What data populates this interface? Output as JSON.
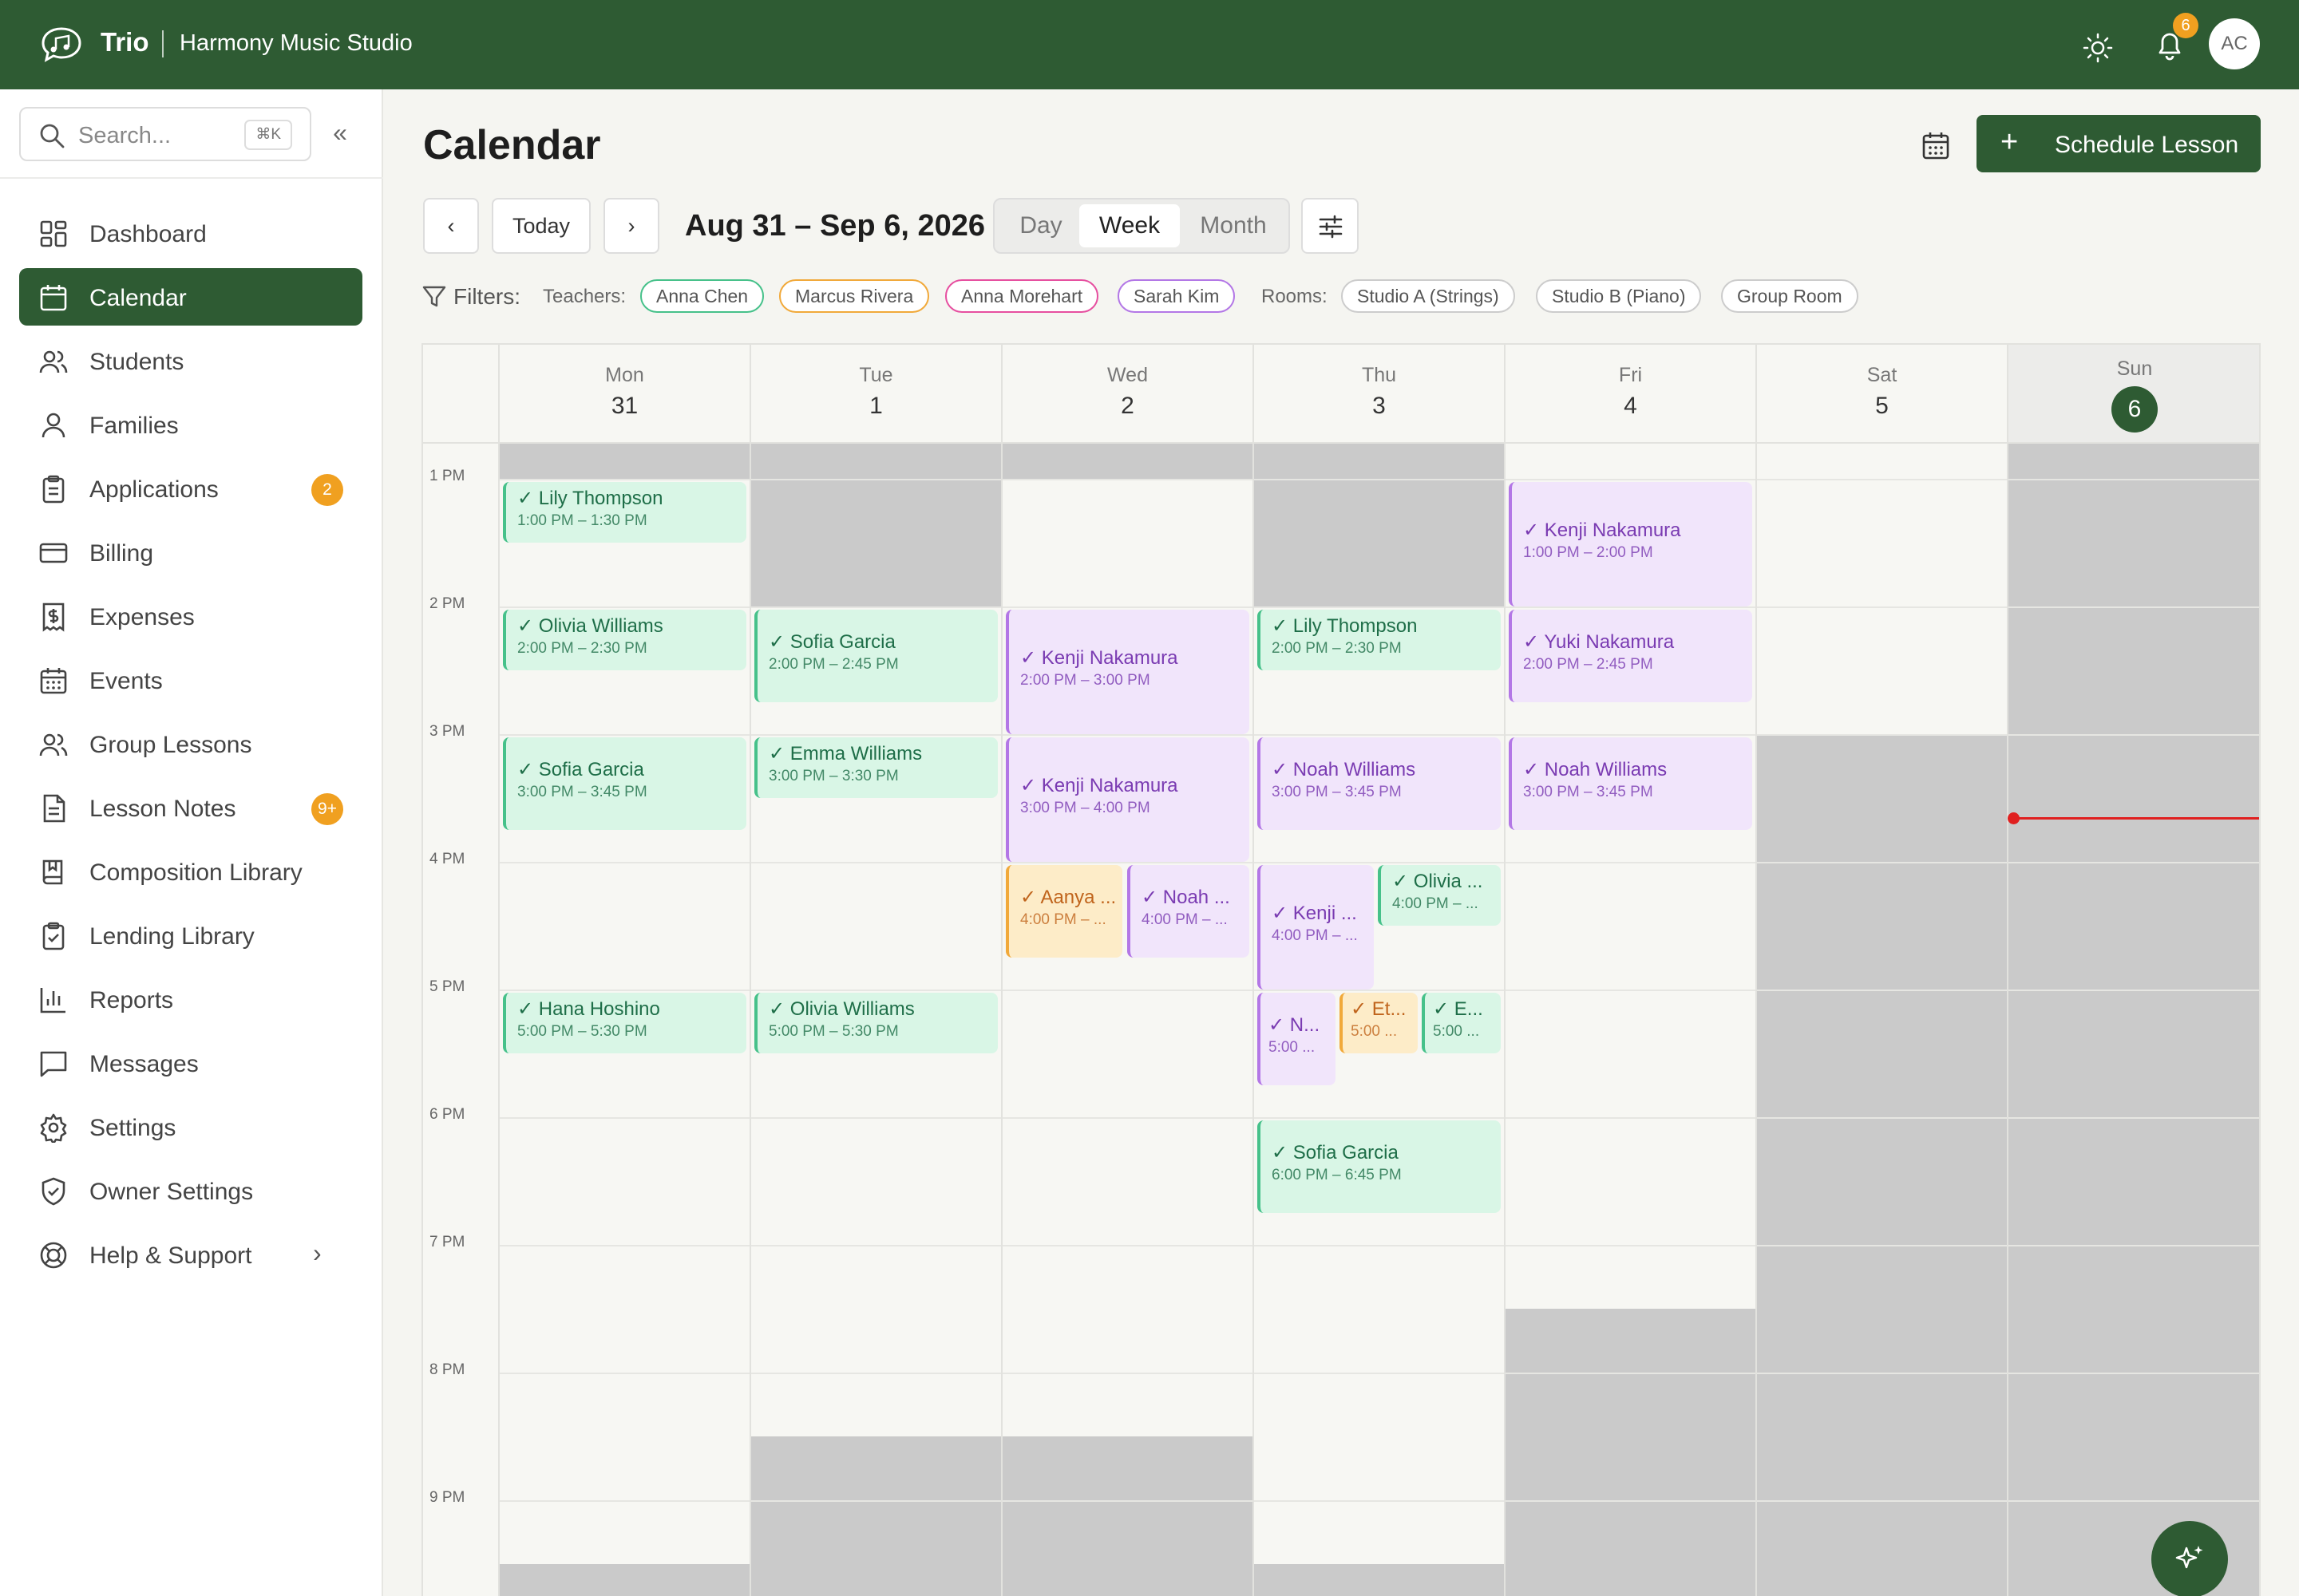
{
  "topbar": {
    "brand": "Trio",
    "studio": "Harmony Music Studio",
    "notifications": "6",
    "avatar": "AC"
  },
  "sidebar": {
    "search_placeholder": "Search...",
    "search_shortcut": "⌘K",
    "items": [
      {
        "label": "Dashboard",
        "icon": "dashboard-icon"
      },
      {
        "label": "Calendar",
        "icon": "calendar-icon",
        "active": true
      },
      {
        "label": "Students",
        "icon": "students-icon"
      },
      {
        "label": "Families",
        "icon": "person-icon"
      },
      {
        "label": "Applications",
        "icon": "clipboard-icon",
        "badge": "2"
      },
      {
        "label": "Billing",
        "icon": "credit-card-icon"
      },
      {
        "label": "Expenses",
        "icon": "receipt-icon"
      },
      {
        "label": "Events",
        "icon": "events-calendar-icon"
      },
      {
        "label": "Group Lessons",
        "icon": "group-icon"
      },
      {
        "label": "Lesson Notes",
        "icon": "notes-icon",
        "badge": "9+"
      },
      {
        "label": "Composition Library",
        "icon": "book-icon"
      },
      {
        "label": "Lending Library",
        "icon": "clipboard-check-icon"
      },
      {
        "label": "Reports",
        "icon": "bar-chart-icon"
      },
      {
        "label": "Messages",
        "icon": "message-icon"
      },
      {
        "label": "Settings",
        "icon": "gear-icon"
      },
      {
        "label": "Owner Settings",
        "icon": "shield-icon"
      },
      {
        "label": "Help & Support",
        "icon": "lifebuoy-icon"
      }
    ]
  },
  "main": {
    "title": "Calendar",
    "schedule_label": "Schedule Lesson",
    "today_label": "Today",
    "range": "Aug 31 – Sep 6, 2026",
    "views": [
      "Day",
      "Week",
      "Month"
    ],
    "active_view": "Week",
    "filters_label": "Filters:",
    "teachers_label": "Teachers:",
    "teachers": [
      {
        "name": "Anna Chen",
        "color": "#46c18a"
      },
      {
        "name": "Marcus Rivera",
        "color": "#f1a93a"
      },
      {
        "name": "Anna Morehart",
        "color": "#e64fa0"
      },
      {
        "name": "Sarah Kim",
        "color": "#b377e6"
      }
    ],
    "rooms_label": "Rooms:",
    "rooms": [
      "Studio A (Strings)",
      "Studio B (Piano)",
      "Group Room"
    ]
  },
  "calendar": {
    "days": [
      {
        "name": "Mon",
        "date": "31"
      },
      {
        "name": "Tue",
        "date": "1"
      },
      {
        "name": "Wed",
        "date": "2"
      },
      {
        "name": "Thu",
        "date": "3"
      },
      {
        "name": "Fri",
        "date": "4"
      },
      {
        "name": "Sat",
        "date": "5"
      },
      {
        "name": "Sun",
        "date": "6",
        "today": true
      }
    ],
    "hours": [
      "1 PM",
      "2 PM",
      "3 PM",
      "4 PM",
      "5 PM",
      "6 PM",
      "7 PM",
      "8 PM",
      "9 PM"
    ],
    "events": [
      {
        "title": "Lily Thompson",
        "time": "1:00 PM – 1:30 PM",
        "color": "g"
      },
      {
        "title": "Olivia Williams",
        "time": "2:00 PM – 2:30 PM",
        "color": "g"
      },
      {
        "title": "Sofia Garcia",
        "time": "3:00 PM – 3:45 PM",
        "color": "g"
      },
      {
        "title": "Hana Hoshino",
        "time": "5:00 PM – 5:30 PM",
        "color": "g"
      },
      {
        "title": "Sofia Garcia",
        "time": "2:00 PM – 2:45 PM",
        "color": "g"
      },
      {
        "title": "Emma Williams",
        "time": "3:00 PM – 3:30 PM",
        "color": "g"
      },
      {
        "title": "Olivia Williams",
        "time": "5:00 PM – 5:30 PM",
        "color": "g"
      },
      {
        "title": "Kenji Nakamura",
        "time": "2:00 PM – 3:00 PM",
        "color": "p"
      },
      {
        "title": "Kenji Nakamura",
        "time": "3:00 PM – 4:00 PM",
        "color": "p"
      },
      {
        "title": "Aanya ...",
        "time": "4:00 PM – ...",
        "color": "o"
      },
      {
        "title": "Noah ...",
        "time": "4:00 PM – ...",
        "color": "p"
      },
      {
        "title": "Lily Thompson",
        "time": "2:00 PM – 2:30 PM",
        "color": "g"
      },
      {
        "title": "Noah Williams",
        "time": "3:00 PM – 3:45 PM",
        "color": "p"
      },
      {
        "title": "Kenji ...",
        "time": "4:00 PM – ...",
        "color": "p"
      },
      {
        "title": "Olivia ...",
        "time": "4:00 PM – ...",
        "color": "g"
      },
      {
        "title": "N...",
        "time": "5:00 ...",
        "color": "p"
      },
      {
        "title": "Et...",
        "time": "5:00 ...",
        "color": "o"
      },
      {
        "title": "E...",
        "time": "5:00 ...",
        "color": "g"
      },
      {
        "title": "Sofia Garcia",
        "time": "6:00 PM – 6:45 PM",
        "color": "g"
      },
      {
        "title": "Kenji Nakamura",
        "time": "1:00 PM – 2:00 PM",
        "color": "p"
      },
      {
        "title": "Yuki Nakamura",
        "time": "2:00 PM – 2:45 PM",
        "color": "p"
      },
      {
        "title": "Noah Williams",
        "time": "3:00 PM – 3:45 PM",
        "color": "p"
      }
    ]
  }
}
